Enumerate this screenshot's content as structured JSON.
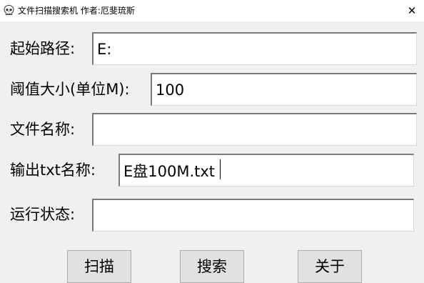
{
  "window": {
    "title": "文件扫描搜索机 作者:厄斐琉斯",
    "icon": "skull-icon",
    "close_symbol": "✕"
  },
  "form": {
    "start_path_label": "起始路径:",
    "start_path_value": "E:",
    "threshold_label": "阈值大小(单位M):",
    "threshold_value": "100",
    "file_name_label": "文件名称:",
    "file_name_value": "",
    "output_label": "输出txt名称:",
    "output_value": "E盘100M.txt",
    "status_label": "运行状态:",
    "status_value": ""
  },
  "buttons": {
    "scan": "扫描",
    "search": "搜索",
    "close": "关于"
  }
}
